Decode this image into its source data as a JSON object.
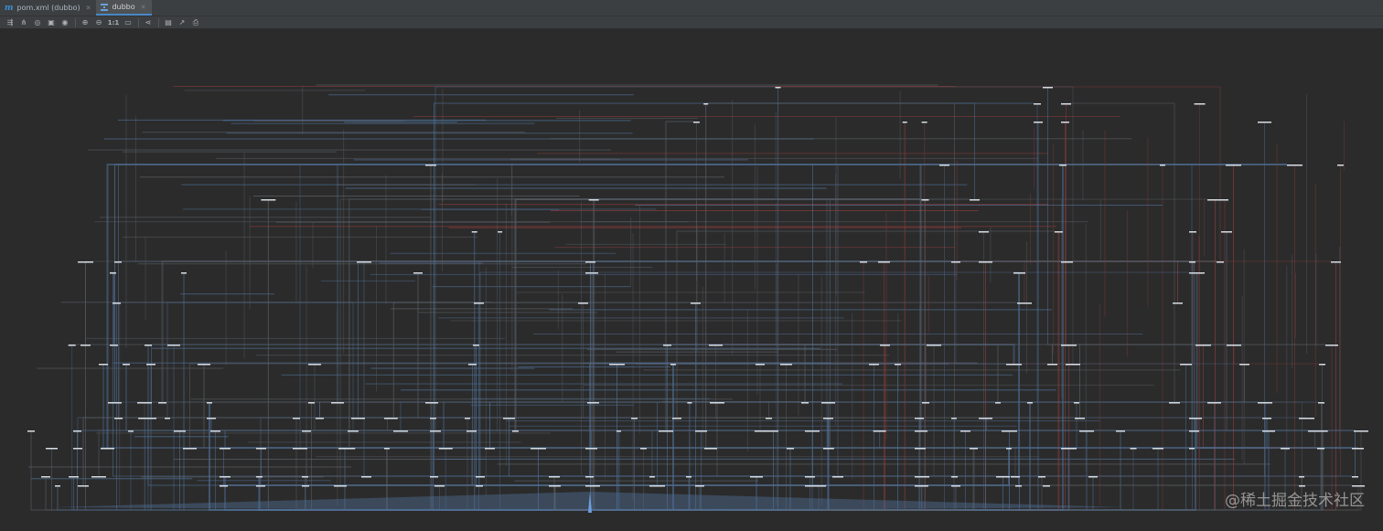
{
  "tabs": [
    {
      "label": "pom.xml (dubbo)",
      "icon": "maven-m-icon",
      "active": false
    },
    {
      "label": "dubbo",
      "icon": "diagram-icon",
      "active": true
    }
  ],
  "toolbar": {
    "buttons": [
      {
        "name": "show-dependencies-button",
        "icon": "dependencies-icon"
      },
      {
        "name": "show-conflicts-button",
        "icon": "conflicts-icon"
      },
      {
        "name": "highlight-paths-button",
        "icon": "highlight-icon"
      },
      {
        "name": "select-all-button",
        "icon": "select-icon"
      },
      {
        "name": "show-hide-button",
        "icon": "eye-icon"
      },
      {
        "name": "zoom-in-button",
        "icon": "zoom-in-icon"
      },
      {
        "name": "zoom-out-button",
        "icon": "zoom-out-icon"
      },
      {
        "name": "actual-size-button",
        "label": "1:1"
      },
      {
        "name": "fit-content-button",
        "icon": "fit-icon"
      },
      {
        "name": "layout-button",
        "icon": "share-icon"
      },
      {
        "name": "save-image-button",
        "icon": "save-icon"
      },
      {
        "name": "export-button",
        "icon": "export-icon"
      },
      {
        "name": "print-button",
        "icon": "print-icon"
      }
    ]
  },
  "colors": {
    "background": "#2b2b2b",
    "edge_blue": "#4f6f96",
    "edge_red": "#8a3c3c",
    "edge_gray": "#5a5f66",
    "node": "#d7dde4"
  },
  "watermark": "@稀土掘金技术社区"
}
